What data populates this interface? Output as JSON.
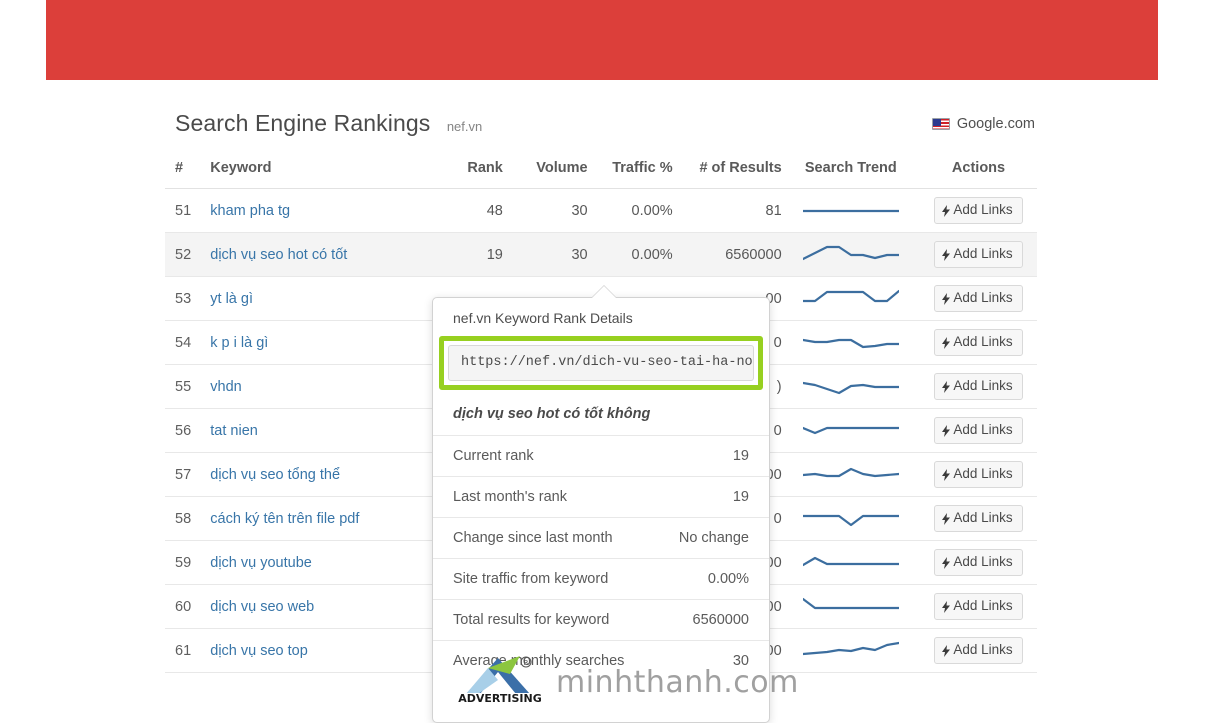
{
  "banner": {
    "color": "#dc3f3a"
  },
  "header": {
    "title": "Search Engine Rankings",
    "domain": "nef.vn",
    "engine_label": "Google.com",
    "flag_icon": "us-flag-icon"
  },
  "table": {
    "columns": [
      "#",
      "Keyword",
      "Rank",
      "Volume",
      "Traffic %",
      "# of Results",
      "Search Trend",
      "Actions"
    ],
    "action_label": "Add Links",
    "action_icon": "bolt-icon",
    "rows": [
      {
        "num": "51",
        "keyword": "kham pha tg",
        "rank": "48",
        "volume": "30",
        "traffic": "0.00%",
        "results": "81",
        "trend": [
          12,
          12,
          12,
          12,
          12,
          12,
          12,
          12
        ],
        "highlight": false
      },
      {
        "num": "52",
        "keyword": "dịch vụ seo hot có tốt",
        "rank": "19",
        "volume": "30",
        "traffic": "0.00%",
        "results": "6560000",
        "trend": [
          16,
          10,
          4,
          4,
          12,
          12,
          15,
          12,
          12
        ],
        "highlight": true
      },
      {
        "num": "53",
        "keyword": "yt là gì",
        "rank": "",
        "volume": "",
        "traffic": "",
        "results": "00",
        "trend": [
          14,
          14,
          5,
          5,
          5,
          5,
          14,
          14,
          4
        ],
        "highlight": false
      },
      {
        "num": "54",
        "keyword": "k p i là gì",
        "rank": "",
        "volume": "",
        "traffic": "",
        "results": "0",
        "trend": [
          9,
          11,
          11,
          9,
          9,
          16,
          15,
          13,
          13
        ],
        "highlight": false
      },
      {
        "num": "55",
        "keyword": "vhdn",
        "rank": "",
        "volume": "",
        "traffic": "",
        "results": ")",
        "trend": [
          8,
          10,
          14,
          18,
          11,
          10,
          12,
          12,
          12
        ],
        "highlight": false
      },
      {
        "num": "56",
        "keyword": "tat nien",
        "rank": "",
        "volume": "",
        "traffic": "",
        "results": "0",
        "trend": [
          9,
          14,
          9,
          9,
          9,
          9,
          9,
          9,
          9
        ],
        "highlight": false
      },
      {
        "num": "57",
        "keyword": "dịch vụ seo tổng thể",
        "rank": "",
        "volume": "",
        "traffic": "",
        "results": "00",
        "trend": [
          12,
          11,
          13,
          13,
          6,
          11,
          13,
          12,
          11
        ],
        "highlight": false
      },
      {
        "num": "58",
        "keyword": "cách ký tên trên file pdf",
        "rank": "",
        "volume": "",
        "traffic": "",
        "results": "0",
        "trend": [
          9,
          9,
          9,
          9,
          18,
          9,
          9,
          9,
          9
        ],
        "highlight": false
      },
      {
        "num": "59",
        "keyword": "dịch vụ youtube",
        "rank": "",
        "volume": "",
        "traffic": "",
        "results": "00",
        "trend": [
          14,
          7,
          13,
          13,
          13,
          13,
          13,
          13,
          13
        ],
        "highlight": false
      },
      {
        "num": "60",
        "keyword": "dịch vụ seo web",
        "rank": "",
        "volume": "",
        "traffic": "",
        "results": "00",
        "trend": [
          4,
          13,
          13,
          13,
          13,
          13,
          13,
          13,
          13
        ],
        "highlight": false
      },
      {
        "num": "61",
        "keyword": "dịch vụ seo top",
        "rank": "",
        "volume": "",
        "traffic": "",
        "results": "00",
        "trend": [
          15,
          14,
          13,
          11,
          12,
          9,
          11,
          6,
          4
        ],
        "highlight": false
      }
    ]
  },
  "popup": {
    "title": "nef.vn Keyword Rank Details",
    "url": "https://nef.vn/dich-vu-seo-tai-ha-noi/",
    "highlight_color": "#97d020",
    "keyword": "dịch vụ seo hot có tốt không",
    "stats": [
      {
        "label": "Current rank",
        "value": "19"
      },
      {
        "label": "Last month's rank",
        "value": "19"
      },
      {
        "label": "Change since last month",
        "value": "No change"
      },
      {
        "label": "Site traffic from keyword",
        "value": "0.00%"
      },
      {
        "label": "Total results for keyword",
        "value": "6560000"
      },
      {
        "label": "Average monthly searches",
        "value": "30"
      }
    ]
  },
  "watermark": {
    "text": "minhthanh.com",
    "logo_label": "ADVERTISING"
  }
}
